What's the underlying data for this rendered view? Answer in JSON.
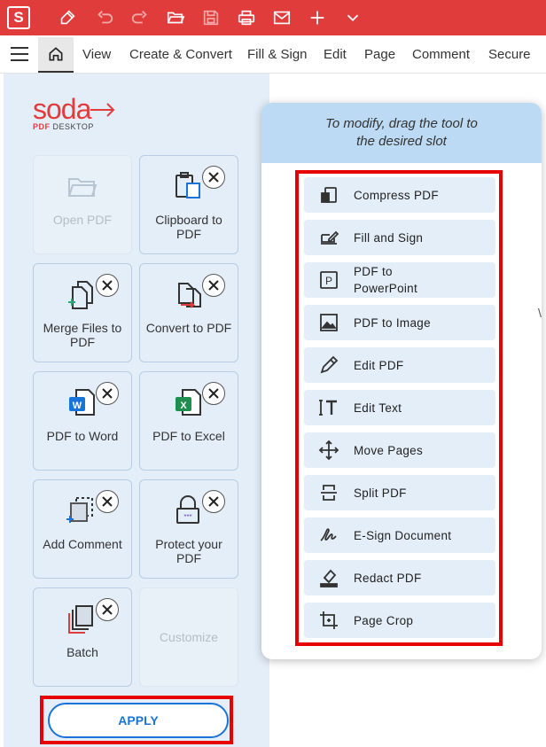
{
  "titlebar": {
    "logo_letter": "S"
  },
  "menu": [
    "View",
    "Create & Convert",
    "Fill & Sign",
    "Edit",
    "Page",
    "Comment",
    "Secure"
  ],
  "brand": {
    "word": "soda",
    "sub_bold": "PDF",
    "sub_rest": " DESKTOP"
  },
  "tiles": [
    {
      "label": "Open PDF"
    },
    {
      "label": "Clipboard to PDF"
    },
    {
      "label": "Merge Files to PDF"
    },
    {
      "label": "Convert to PDF"
    },
    {
      "label": "PDF to Word"
    },
    {
      "label": "PDF to Excel"
    },
    {
      "label": "Add Comment"
    },
    {
      "label": "Protect your PDF"
    },
    {
      "label": "Batch"
    },
    {
      "label": "Customize"
    }
  ],
  "apply_label": "APPLY",
  "popover": {
    "line1": "To modify, drag the tool to",
    "line2": "the desired slot"
  },
  "slots": [
    {
      "label": "Compress PDF"
    },
    {
      "label": "Fill and Sign"
    },
    {
      "label1": "PDF to",
      "label2": "PowerPoint"
    },
    {
      "label": "PDF to Image"
    },
    {
      "label": "Edit PDF"
    },
    {
      "label": "Edit Text"
    },
    {
      "label": "Move Pages"
    },
    {
      "label": "Split PDF"
    },
    {
      "label": "E-Sign Document"
    },
    {
      "label": "Redact PDF"
    },
    {
      "label": "Page Crop"
    }
  ],
  "edge_char": "\\",
  "colors": {
    "brand_red": "#e13c3c",
    "panel_bg": "#e4eef8",
    "accent_blue": "#1a73d8",
    "highlight_red": "#e60000"
  }
}
